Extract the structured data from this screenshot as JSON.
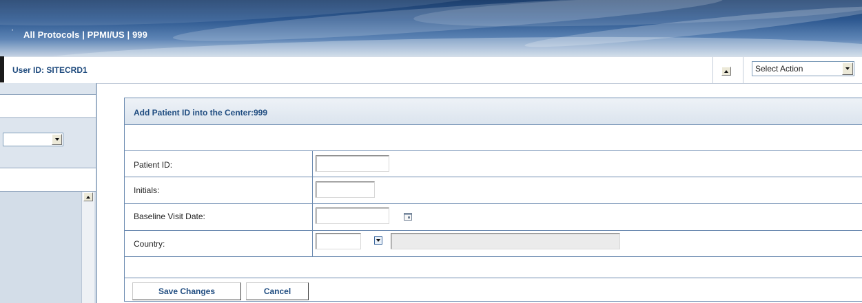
{
  "banner": {
    "tick": "'",
    "title": "All Protocols | PPMI/US | 999"
  },
  "userbar": {
    "user_id": "User ID: SITECRD1",
    "action_select": {
      "value": "Select Action"
    }
  },
  "form": {
    "title": "Add Patient ID into the Center:999",
    "fields": [
      {
        "label": "Patient ID:",
        "value": ""
      },
      {
        "label": "Initials:",
        "value": ""
      },
      {
        "label": "Baseline Visit Date:",
        "value": ""
      },
      {
        "label": "Country:",
        "value": "",
        "name_value": ""
      }
    ],
    "buttons": {
      "save": "Save Changes",
      "cancel": "Cancel"
    }
  },
  "icons": {
    "collapse": "chevron-up-icon",
    "calendar": "calendar-icon",
    "lookup": "dropdown-lookup-icon"
  },
  "colors": {
    "banner": "#2d5890",
    "title_text": "#1f4c80",
    "border": "#6b8ab0",
    "sidebar": "#dfe6ee"
  }
}
